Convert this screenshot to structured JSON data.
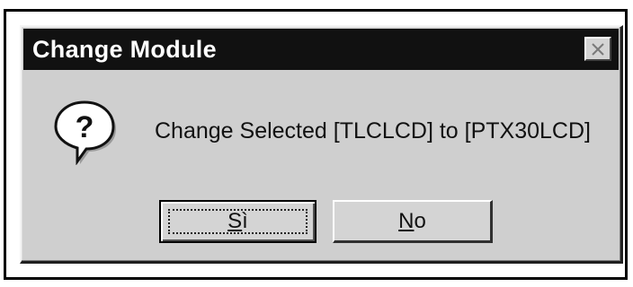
{
  "dialog": {
    "title": "Change Module",
    "close_icon": "close-icon",
    "question_icon": "question-icon",
    "message": "Change Selected [TLCLCD] to [PTX30LCD]",
    "buttons": {
      "yes": {
        "label": "Sì",
        "mnemonic": "S",
        "rest": "ì",
        "focused": true
      },
      "no": {
        "label": "No",
        "mnemonic": "N",
        "rest": "o",
        "focused": false
      }
    }
  },
  "colors": {
    "titlebar": "#111111",
    "title_text": "#ffffff",
    "dialog_face": "#cfcfcf"
  }
}
